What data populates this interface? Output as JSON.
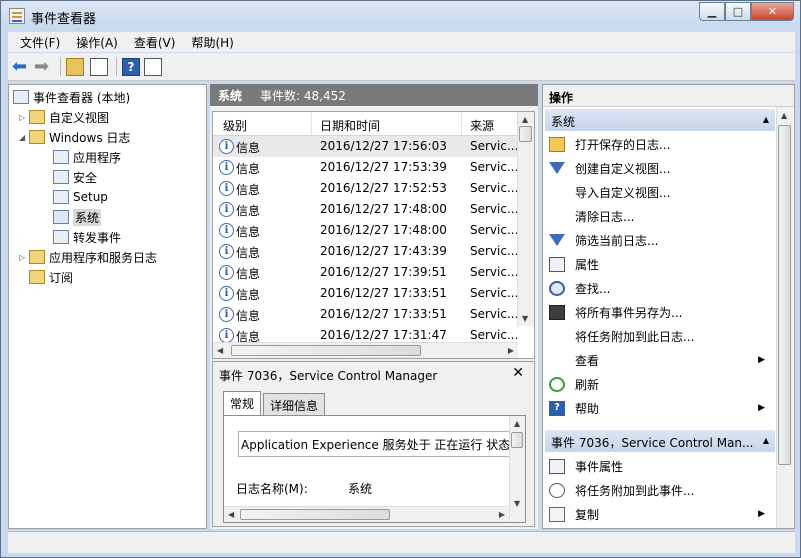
{
  "window": {
    "title": "事件查看器"
  },
  "menu": [
    "文件(F)",
    "操作(A)",
    "查看(V)",
    "帮助(H)"
  ],
  "tree": {
    "root": "事件查看器 (本地)",
    "custom_views": "自定义视图",
    "windows_logs": "Windows 日志",
    "logs": [
      "应用程序",
      "安全",
      "Setup",
      "系统",
      "转发事件"
    ],
    "apps_services": "应用程序和服务日志",
    "subscriptions": "订阅"
  },
  "events_header": {
    "log_name": "系统",
    "count_text": "事件数: 48,452"
  },
  "columns": [
    "级别",
    "日期和时间",
    "来源"
  ],
  "events": [
    {
      "level": "信息",
      "datetime": "2016/12/27 17:56:03",
      "source": "Servic..."
    },
    {
      "level": "信息",
      "datetime": "2016/12/27 17:53:39",
      "source": "Servic..."
    },
    {
      "level": "信息",
      "datetime": "2016/12/27 17:52:53",
      "source": "Servic..."
    },
    {
      "level": "信息",
      "datetime": "2016/12/27 17:48:00",
      "source": "Servic..."
    },
    {
      "level": "信息",
      "datetime": "2016/12/27 17:48:00",
      "source": "Servic..."
    },
    {
      "level": "信息",
      "datetime": "2016/12/27 17:43:39",
      "source": "Servic..."
    },
    {
      "level": "信息",
      "datetime": "2016/12/27 17:39:51",
      "source": "Servic..."
    },
    {
      "level": "信息",
      "datetime": "2016/12/27 17:33:51",
      "source": "Servic..."
    },
    {
      "level": "信息",
      "datetime": "2016/12/27 17:33:51",
      "source": "Servic..."
    },
    {
      "level": "信息",
      "datetime": "2016/12/27 17:31:47",
      "source": "Servic..."
    }
  ],
  "detail": {
    "title": "事件 7036，Service Control Manager",
    "tabs": [
      "常规",
      "详细信息"
    ],
    "message": "Application Experience 服务处于 正在运行 状态。",
    "log_name_label": "日志名称(M):",
    "log_name_value": "系统"
  },
  "actions": {
    "header": "操作",
    "section1": "系统",
    "items1": [
      "打开保存的日志...",
      "创建自定义视图...",
      "导入自定义视图...",
      "清除日志...",
      "筛选当前日志...",
      "属性",
      "查找...",
      "将所有事件另存为...",
      "将任务附加到此日志...",
      "查看",
      "刷新",
      "帮助"
    ],
    "section2": "事件 7036，Service Control Man...",
    "items2": [
      "事件属性",
      "将任务附加到此事件...",
      "复制"
    ]
  }
}
